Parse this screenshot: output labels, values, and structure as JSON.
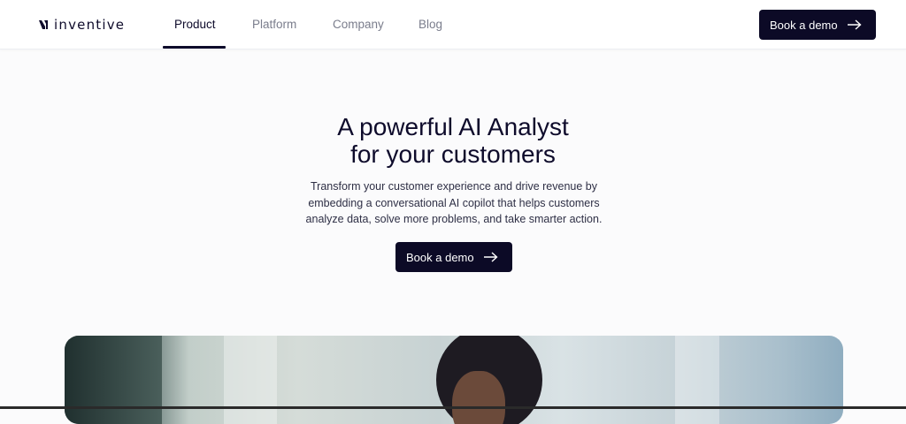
{
  "brand": {
    "name": "inventive"
  },
  "nav": {
    "links": [
      {
        "label": "Product",
        "active": true
      },
      {
        "label": "Platform",
        "active": false
      },
      {
        "label": "Company",
        "active": false
      },
      {
        "label": "Blog",
        "active": false
      }
    ],
    "cta_label": "Book a demo"
  },
  "hero": {
    "headline_line1": "A powerful AI Analyst",
    "headline_line2": "for your customers",
    "subtext": "Transform your customer experience and drive revenue by embedding a conversational AI copilot that helps customers analyze data, solve more problems, and take smarter action.",
    "cta_label": "Book a demo"
  },
  "icons": {
    "cta_arrow": "arrow-right-icon",
    "logo": "inventive-logo-icon"
  },
  "colors": {
    "primary": "#0c0a26",
    "text": "#0e0b2b",
    "muted": "#7a7d8c",
    "background": "#fbfbfc"
  }
}
